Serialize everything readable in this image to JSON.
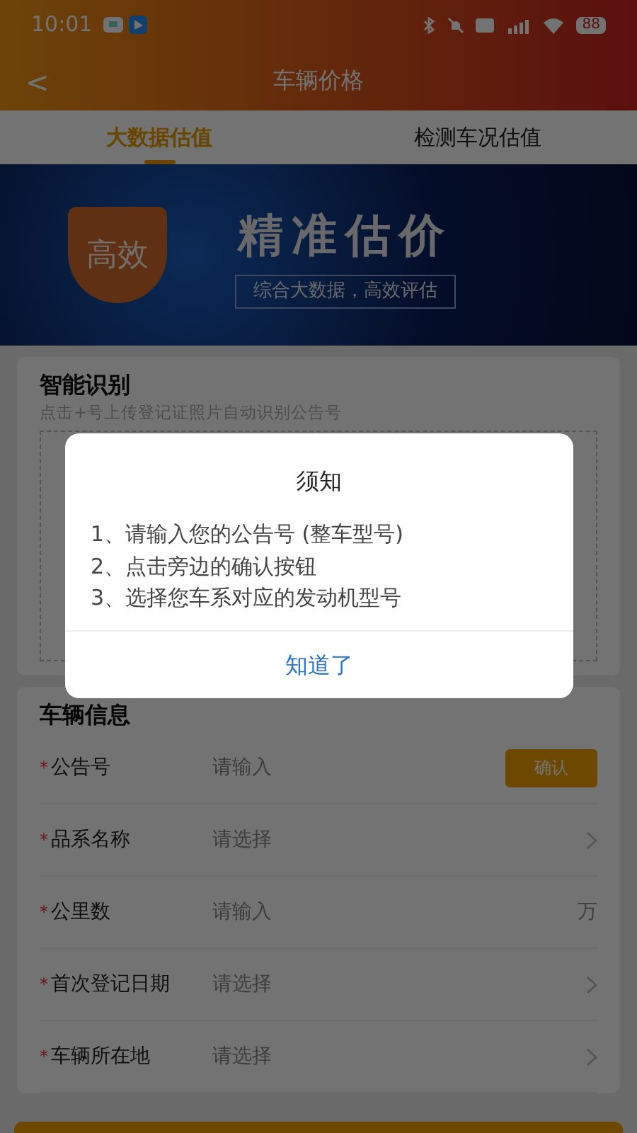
{
  "status_bar": {
    "time": "10:01",
    "battery": "88"
  },
  "nav": {
    "back": "<",
    "title": "车辆价格"
  },
  "tabs": [
    {
      "label": "大数据估值",
      "selected": true
    },
    {
      "label": "检测车况估值",
      "selected": false
    }
  ],
  "banner": {
    "badge": "高效",
    "title": "精准估价",
    "subtitle": "综合大数据，高效评估"
  },
  "recognition": {
    "title": "智能识别",
    "hint": "点击+号上传登记证照片自动识别公告号"
  },
  "vehicle_info": {
    "title": "车辆信息",
    "rows": [
      {
        "kind": "input",
        "required_mark": "*",
        "label": "公告号",
        "placeholder": "请输入",
        "button": "确认"
      },
      {
        "kind": "select",
        "required_mark": "*",
        "label": "品系名称",
        "placeholder": "请选择"
      },
      {
        "kind": "input",
        "required_mark": "*",
        "label": "公里数",
        "placeholder": "请输入",
        "unit": "万"
      },
      {
        "kind": "select",
        "required_mark": "*",
        "label": "首次登记日期",
        "placeholder": "请选择"
      },
      {
        "kind": "select",
        "required_mark": "*",
        "label": "车辆所在地",
        "placeholder": "请选择"
      }
    ]
  },
  "dialog": {
    "title": "须知",
    "lines": [
      "1、请输入您的公告号 (整车型号)",
      "2、点击旁边的确认按钮",
      "3、选择您车系对应的发动机型号"
    ],
    "button": "知道了"
  }
}
